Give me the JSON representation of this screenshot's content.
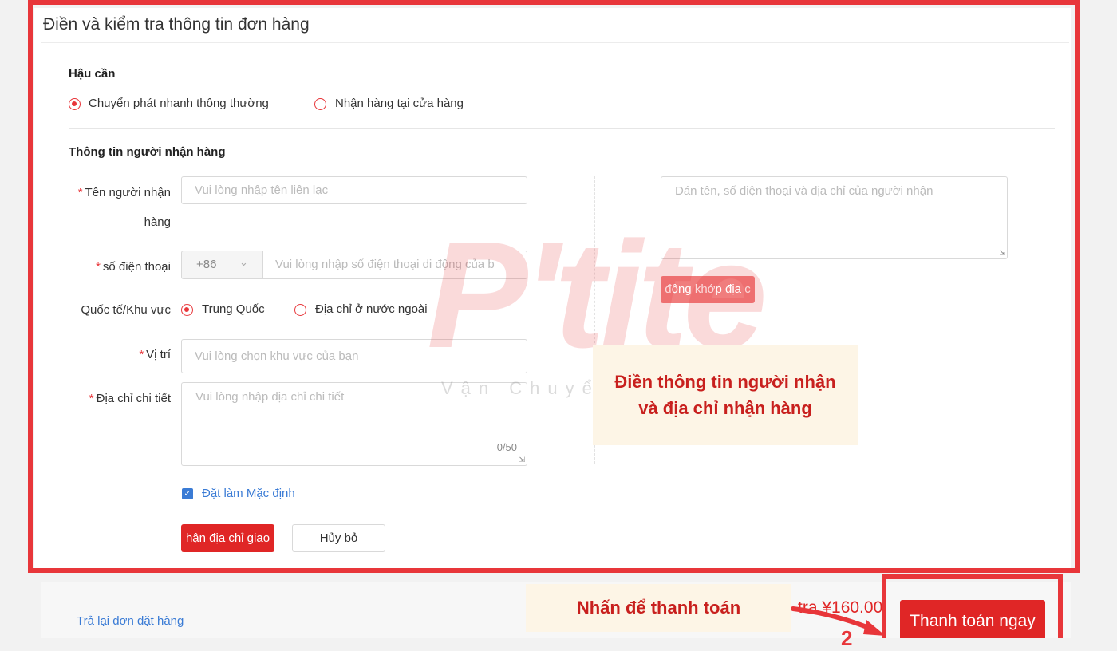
{
  "card_title": "Điền và kiểm tra thông tin đơn hàng",
  "logistics": {
    "title": "Hậu cần",
    "options": [
      "Chuyển phát nhanh thông thường",
      "Nhận hàng tại cửa hàng"
    ],
    "selected": 0
  },
  "recipient": {
    "title": "Thông tin người nhận hàng",
    "name_label_1": "Tên người nhận",
    "name_label_2": "hàng",
    "name_placeholder": "Vui lòng nhập tên liên lạc",
    "phone_label": "số điện thoại",
    "country_code": "+86",
    "phone_placeholder": "Vui lòng nhập số điện thoại di động của b",
    "region_label": "Quốc tế/Khu vực",
    "region_options": [
      "Trung Quốc",
      "Địa chỉ ở nước ngoài"
    ],
    "location_label": "Vị trí",
    "location_placeholder": "Vui lòng chọn khu vực của bạn",
    "address_label": "Địa chỉ chi tiết",
    "address_placeholder": "Vui lòng nhập địa chỉ chi tiết",
    "address_counter": "0/50",
    "default_label": "Đặt làm Mặc định",
    "default_checked": true,
    "save_button": "hận địa chỉ giao",
    "cancel_button": "Hủy bỏ",
    "paste_placeholder": "Dán tên, số điện thoại và địa chỉ của người nhận",
    "match_button": "động khớp địa c"
  },
  "footer": {
    "back_link": "Trả lại đơn đặt hàng",
    "price_partial": "tra ¥160.00",
    "pay_button": "Thanh toán ngay"
  },
  "annotations": {
    "fill_info_line1": "Điền thông tin người nhận",
    "fill_info_line2": "và địa chỉ nhận hàng",
    "click_pay": "Nhấn để thanh toán",
    "step_number": "2"
  },
  "watermark": {
    "logo": "P'tite",
    "tagline": "Vận Chuyển"
  },
  "colors": {
    "accent_red": "#e02626",
    "frame_red": "#e8363a",
    "link_blue": "#3a7bd5",
    "annotation_bg": "#fdf5e6"
  }
}
